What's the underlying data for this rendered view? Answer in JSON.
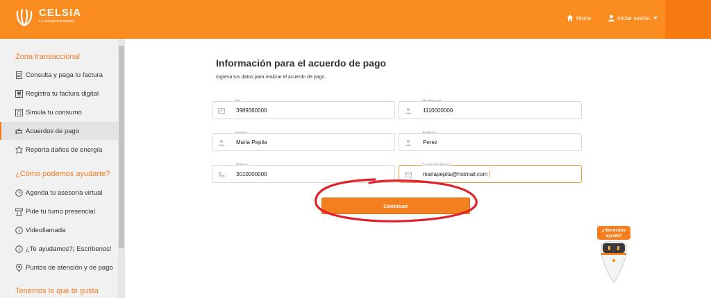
{
  "header": {
    "brand": "CELSIA",
    "tagline": "La energía que quieres",
    "home_label": "Home",
    "login_label": "Iniciar sesión",
    "colors": {
      "primary": "#fb8c1f",
      "text": "#ffffff"
    }
  },
  "sidebar": {
    "sections": [
      {
        "title": "Zona transaccional"
      },
      {
        "title": "¿Cómo podemos ayudarte?"
      },
      {
        "title": "Tenemos lo que te gusta"
      }
    ],
    "items": [
      {
        "label": "Consulta y paga tu factura",
        "icon": "document-icon"
      },
      {
        "label": "Registra tu factura digital",
        "icon": "digital-invoice-icon"
      },
      {
        "label": "Simula tu consumo",
        "icon": "calculator-icon"
      },
      {
        "label": "Acuerdos de pago",
        "icon": "handshake-icon",
        "active": true
      },
      {
        "label": "Reporta daños de energía",
        "icon": "alert-icon"
      },
      {
        "label": "Agenda tu asesoría virtual",
        "icon": "clock-icon"
      },
      {
        "label": "Pide tu turno presencial",
        "icon": "ticket-icon"
      },
      {
        "label": "Videollamada",
        "icon": "info-icon"
      },
      {
        "label": "¿Te ayudamos?¡ Escríbenos!",
        "icon": "info-icon"
      },
      {
        "label": "Puntos de atención y de pago",
        "icon": "location-icon"
      }
    ]
  },
  "main": {
    "title": "Información para el acuerdo de pago",
    "subtitle": "Ingresa tus datos para realizar el acuerdo de pago.",
    "fields": [
      {
        "label": "Nic",
        "value": "3989360000",
        "icon": "card-icon"
      },
      {
        "label": "Identificación",
        "value": "1110000000",
        "icon": "user-icon"
      },
      {
        "label": "Nombre",
        "value": "Maria Pepila",
        "icon": "user-icon"
      },
      {
        "label": "Apellidos",
        "value": "Perez",
        "icon": "user-icon"
      },
      {
        "label": "Teléfono",
        "value": "3010000000",
        "icon": "phone-icon"
      },
      {
        "label": "Correo electrónico",
        "value": "mariapepita@hotmail.com",
        "icon": "mail-icon",
        "focused": true
      }
    ],
    "submit_label": "Continuar",
    "accent": "#f47f1f",
    "annotation_color": "#e0202a"
  },
  "chatbot": {
    "bubble_line1": "¿Necesitas",
    "bubble_line2": "ayuda?"
  }
}
